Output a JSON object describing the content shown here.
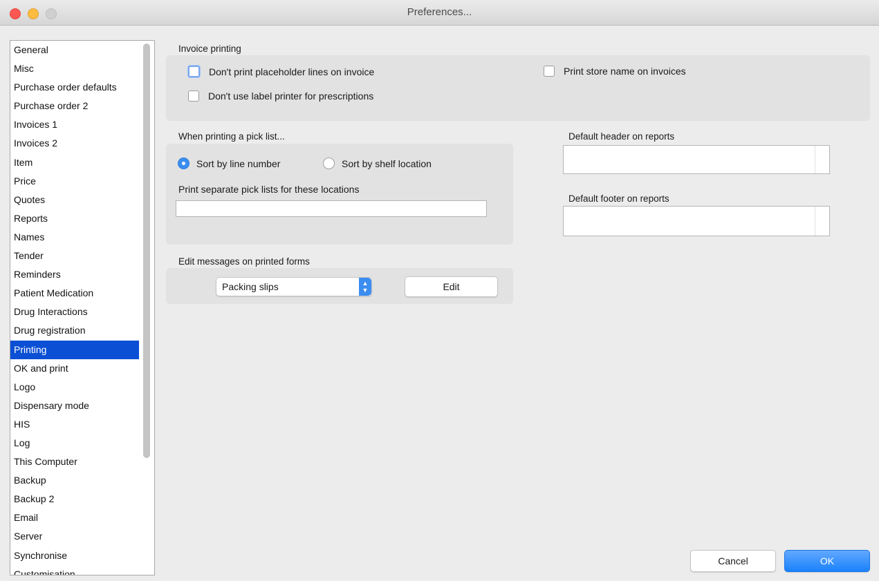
{
  "window": {
    "title": "Preferences..."
  },
  "sidebar": {
    "items": [
      "General",
      "Misc",
      "Purchase order defaults",
      "Purchase order 2",
      "Invoices 1",
      "Invoices 2",
      "Item",
      "Price",
      "Quotes",
      "Reports",
      "Names",
      "Tender",
      "Reminders",
      "Patient Medication",
      "Drug Interactions",
      "Drug registration",
      "Printing",
      "OK and print",
      "Logo",
      "Dispensary mode",
      "HIS",
      "Log",
      "This Computer",
      "Backup",
      "Backup 2",
      "Email",
      "Server",
      "Synchronise",
      "Customisation"
    ],
    "selected": "Printing"
  },
  "invoice_printing": {
    "label": "Invoice printing",
    "no_placeholder": "Don't print placeholder lines on invoice",
    "no_label_printer": "Don't use label printer for prescriptions",
    "store_name": "Print store name on invoices"
  },
  "pick_list": {
    "label": "When printing a pick list...",
    "sort_line": "Sort by line number",
    "sort_shelf": "Sort by shelf location",
    "separate_label": "Print separate pick lists for these locations",
    "separate_value": ""
  },
  "reports": {
    "header_label": "Default header on reports",
    "footer_label": "Default footer on reports"
  },
  "messages": {
    "label": "Edit messages on printed forms",
    "selected_form": "Packing slips",
    "edit_label": "Edit"
  },
  "footer": {
    "cancel_label": "Cancel",
    "ok_label": "OK"
  }
}
